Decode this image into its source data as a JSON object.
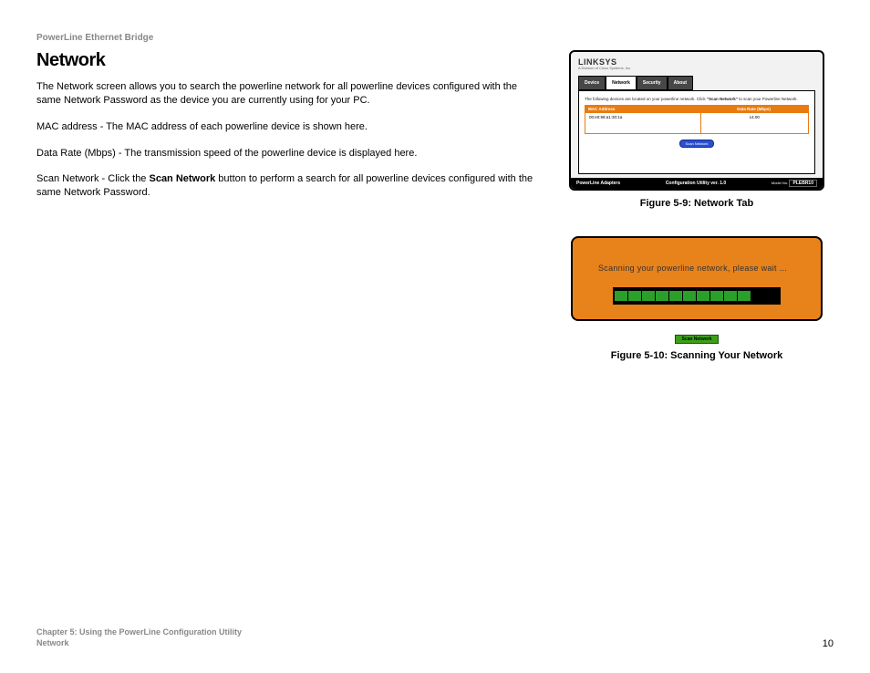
{
  "header": {
    "product": "PowerLine Ethernet Bridge"
  },
  "section": {
    "title": "Network",
    "p1": "The Network screen allows you to search the powerline network for all powerline devices configured with the same Network Password as the device you are currently using for your PC.",
    "p2": "MAC address - The MAC address of each powerline device is shown here.",
    "p3": "Data Rate (Mbps) - The transmission speed of the powerline device is displayed here.",
    "p4a": "Scan Network - Click the ",
    "p4bold": "Scan Network",
    "p4b": " button to perform a search for all powerline devices configured with the same Network Password."
  },
  "fig1": {
    "brand": "LINKSYS",
    "brand_sub": "A Division of Cisco Systems, Inc.",
    "tabs": [
      "Device",
      "Network",
      "Security",
      "About"
    ],
    "active_tab": 1,
    "instr_a": "The following devices are located on your powerline network. Click ",
    "instr_bold": "\"Scan Network\"",
    "instr_b": " to scan your Powerline Network.",
    "col_mac": "MAC Address",
    "col_rate": "Data Rate (Mbps)",
    "row_mac": "00:e0:98:a1:30:1a",
    "row_rate": "14.00",
    "scan_label": "Scan Network",
    "footer_left": "PowerLine Adapters",
    "footer_mid": "Configuration Utility ver. 1.0",
    "footer_model_label": "Model No.",
    "footer_model": "PLEBR10",
    "caption": "Figure 5-9: Network Tab"
  },
  "fig2": {
    "text": "Scanning your powerline network, please wait ...",
    "scan_label": "Scan Network",
    "caption": "Figure 5-10: Scanning Your Network"
  },
  "footer": {
    "chapter": "Chapter 5: Using the PowerLine Configuration Utility",
    "subsection": "Network",
    "page": "10"
  }
}
